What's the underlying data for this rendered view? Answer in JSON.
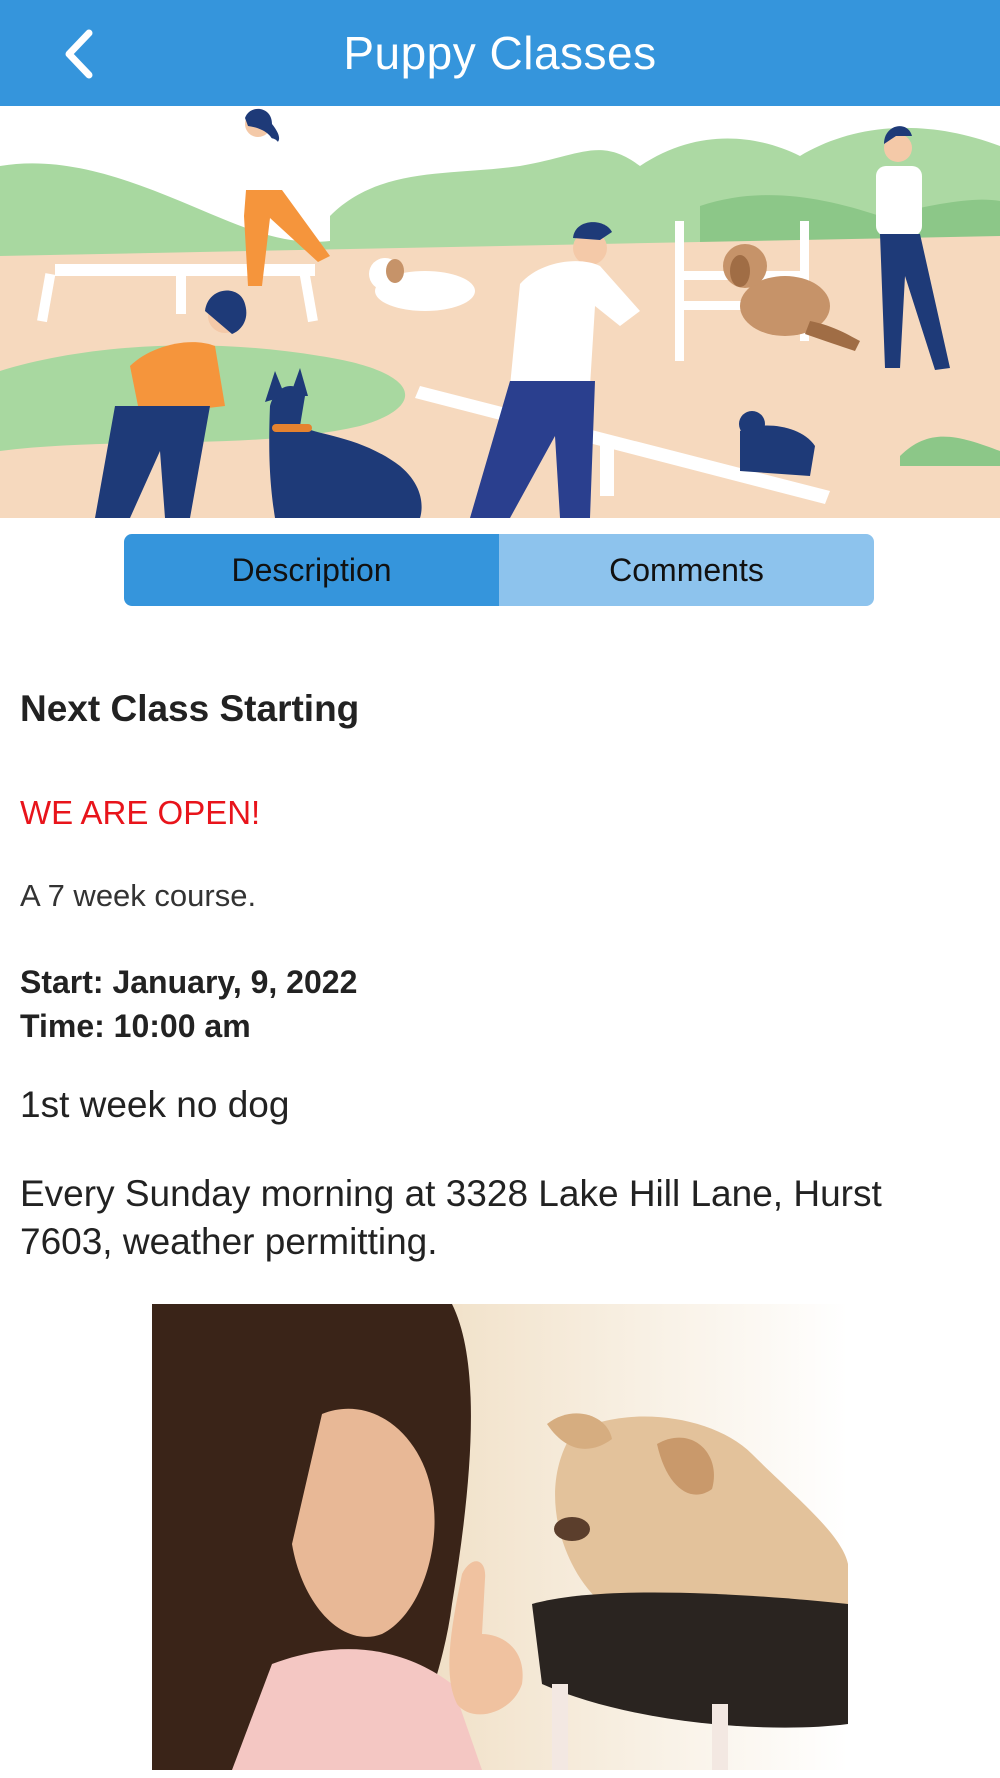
{
  "header": {
    "title": "Puppy Classes",
    "back_icon": "chevron-left-icon"
  },
  "colors": {
    "header_bg": "#3595dc",
    "tab_active": "#3595dc",
    "tab_inactive": "#8dc3ed",
    "open_text": "#e8141b"
  },
  "tabs": [
    {
      "label": "Description",
      "active": true
    },
    {
      "label": "Comments",
      "active": false
    }
  ],
  "content": {
    "heading": "Next Class Starting",
    "open_notice": "WE ARE OPEN!",
    "course_length": "A 7 week course.",
    "start": "Start: January, 9, 2022",
    "time": "Time: 10:00 am",
    "first_week": "1st week no dog",
    "address": "Every Sunday morning at 3328 Lake Hill Lane, Hurst 7603, weather permitting."
  }
}
